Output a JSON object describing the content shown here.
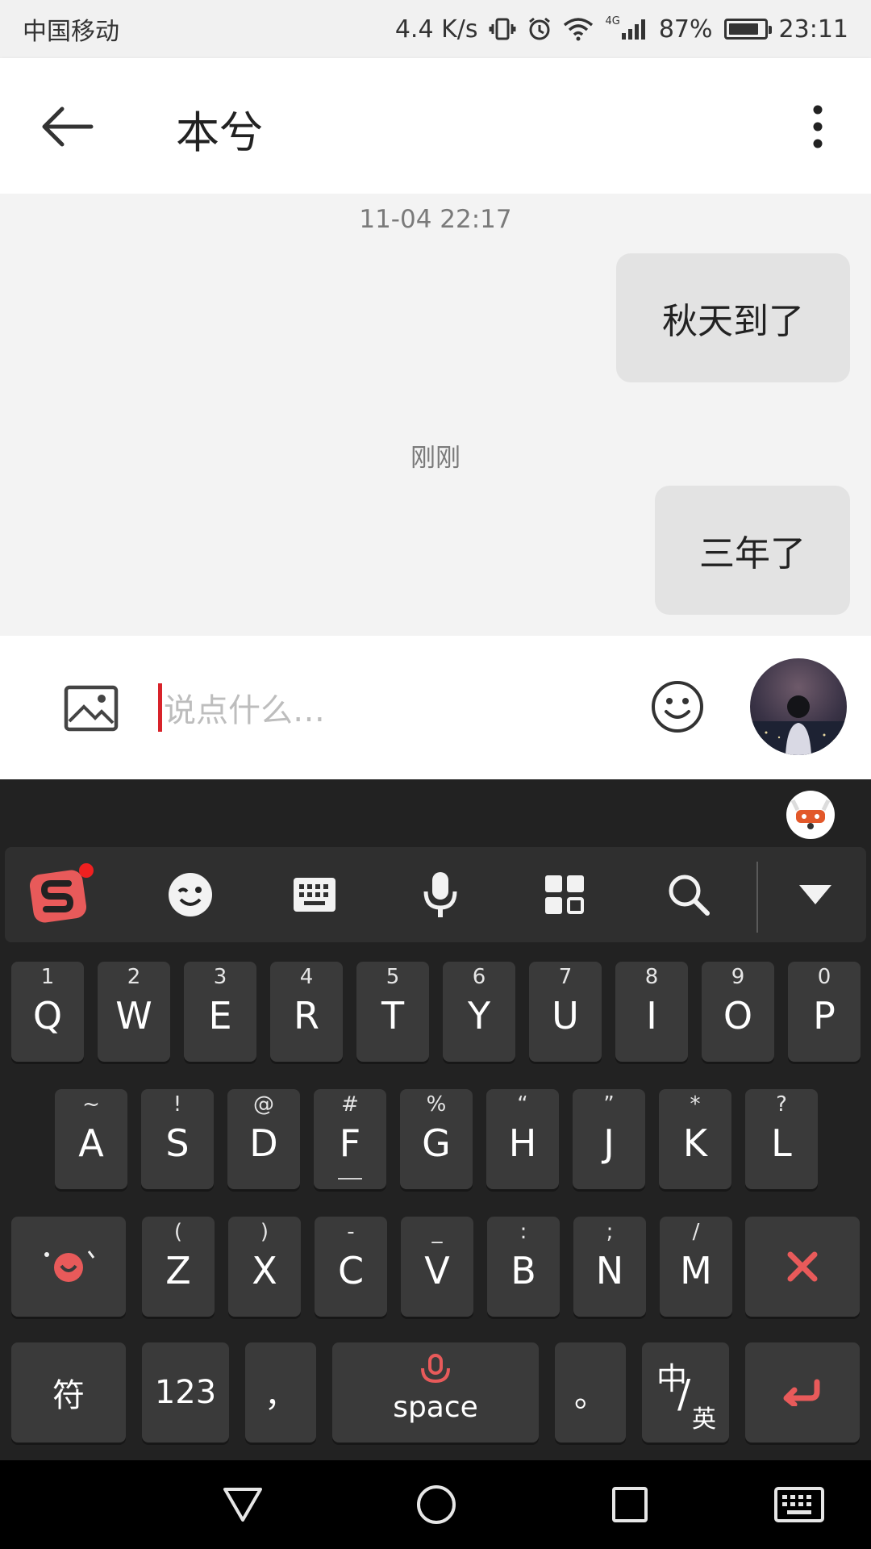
{
  "status_bar": {
    "carrier": "中国移动",
    "speed": "4.4 K/s",
    "network": "4G",
    "battery_percent": "87%",
    "battery_level": 0.87,
    "time": "23:11"
  },
  "header": {
    "title": "本兮",
    "icons": [
      "arrow-left-icon",
      "more-vertical-icon"
    ]
  },
  "chat": {
    "messages": [
      {
        "timestamp": "11-04 22:17",
        "text": "秋天到了"
      },
      {
        "timestamp": "刚刚",
        "text": "三年了"
      }
    ]
  },
  "input_bar": {
    "placeholder": "说点什么…",
    "icons": [
      "image-icon",
      "emoji-icon",
      "avatar"
    ]
  },
  "keyboard": {
    "toolbar_icons": [
      "sogou-logo-icon",
      "emoji-wink-icon",
      "keyboard-icon",
      "microphone-icon",
      "apps-grid-icon",
      "search-icon",
      "collapse-triangle-icon"
    ],
    "row1": [
      {
        "sub": "1",
        "main": "Q"
      },
      {
        "sub": "2",
        "main": "W"
      },
      {
        "sub": "3",
        "main": "E"
      },
      {
        "sub": "4",
        "main": "R"
      },
      {
        "sub": "5",
        "main": "T"
      },
      {
        "sub": "6",
        "main": "Y"
      },
      {
        "sub": "7",
        "main": "U"
      },
      {
        "sub": "8",
        "main": "I"
      },
      {
        "sub": "9",
        "main": "O"
      },
      {
        "sub": "0",
        "main": "P"
      }
    ],
    "row2": [
      {
        "sub": "~",
        "main": "A"
      },
      {
        "sub": "!",
        "main": "S"
      },
      {
        "sub": "@",
        "main": "D"
      },
      {
        "sub": "#",
        "main": "F"
      },
      {
        "sub": "%",
        "main": "G"
      },
      {
        "sub": "“",
        "main": "H"
      },
      {
        "sub": "”",
        "main": "J"
      },
      {
        "sub": "*",
        "main": "K"
      },
      {
        "sub": "?",
        "main": "L"
      }
    ],
    "row3": [
      {
        "sub": "(",
        "main": "Z"
      },
      {
        "sub": ")",
        "main": "X"
      },
      {
        "sub": "-",
        "main": "C"
      },
      {
        "sub": "_",
        "main": "V"
      },
      {
        "sub": ":",
        "main": "B"
      },
      {
        "sub": ";",
        "main": "N"
      },
      {
        "sub": "/",
        "main": "M"
      }
    ],
    "bottom": {
      "symbol": "符",
      "numbers": "123",
      "comma": "，",
      "space": "space",
      "period": "。",
      "lang_zh": "中",
      "lang_slash": "/",
      "lang_en": "英"
    },
    "accent_color": "#e85a5a"
  },
  "navbar": {
    "icons": [
      "back-triangle-icon",
      "home-circle-icon",
      "recents-square-icon",
      "keyboard-switch-icon"
    ]
  }
}
